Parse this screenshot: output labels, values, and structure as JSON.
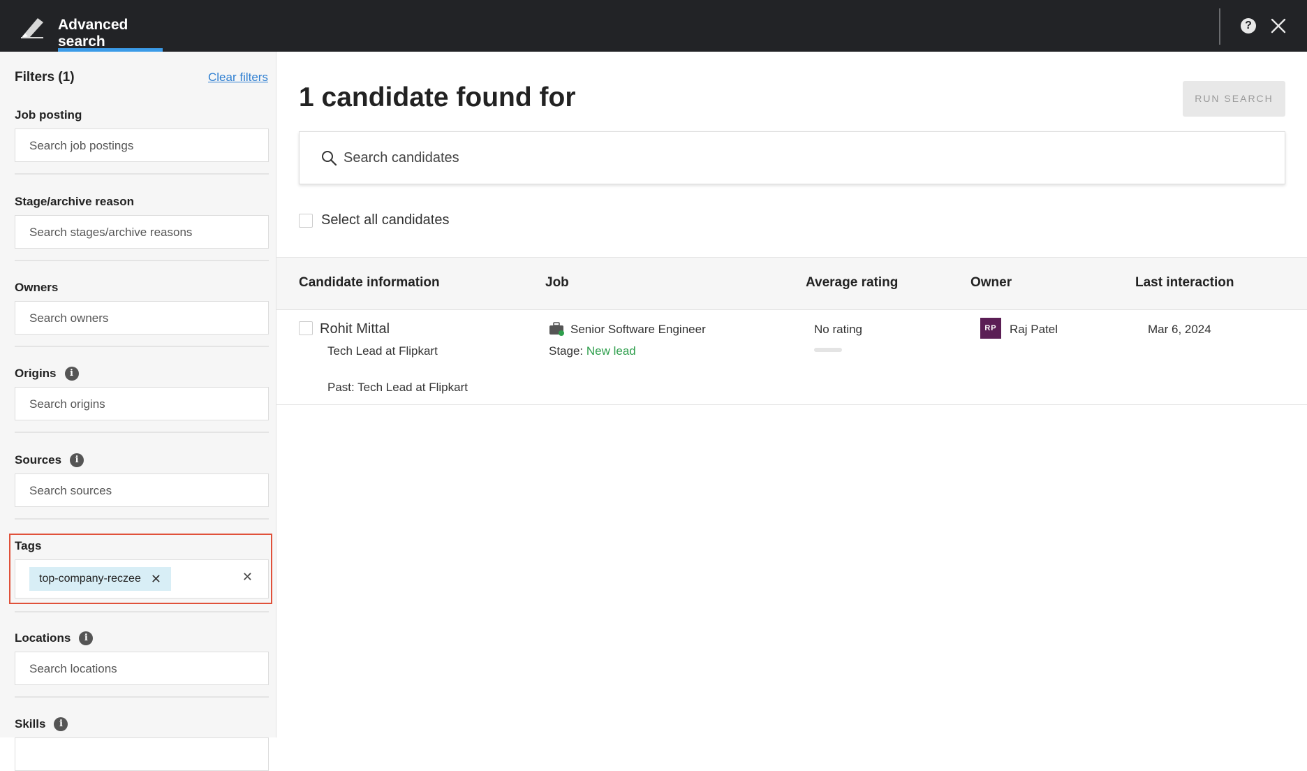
{
  "header": {
    "title": "Advanced search",
    "help_icon": "question-circle-icon",
    "close_icon": "close-icon"
  },
  "sidebar": {
    "filters_title": "Filters (1)",
    "clear_filters": "Clear filters",
    "job_posting": {
      "label": "Job posting",
      "placeholder": "Search job postings"
    },
    "stage": {
      "label": "Stage/archive reason",
      "placeholder": "Search stages/archive reasons"
    },
    "owners": {
      "label": "Owners",
      "placeholder": "Search owners"
    },
    "origins": {
      "label": "Origins",
      "placeholder": "Search origins"
    },
    "sources": {
      "label": "Sources",
      "placeholder": "Search sources"
    },
    "tags": {
      "label": "Tags",
      "chip": "top-company-reczee",
      "chip_remove": "✕",
      "clear": "✕"
    },
    "locations": {
      "label": "Locations",
      "placeholder": "Search locations"
    },
    "skills": {
      "label": "Skills"
    },
    "info_glyph": "i"
  },
  "main": {
    "title": "1 candidate found for",
    "run_search": "RUN SEARCH",
    "search_placeholder": "Search candidates",
    "select_all": "Select all candidates"
  },
  "table": {
    "columns": [
      "Candidate information",
      "Job",
      "Average rating",
      "Owner",
      "Last interaction"
    ],
    "rows": [
      {
        "name": "Rohit Mittal",
        "headline": "Tech Lead at Flipkart",
        "past": "Past: Tech Lead at Flipkart",
        "job": "Senior Software Engineer",
        "stage_label": "Stage:",
        "stage_value": "New lead",
        "rating": "No rating",
        "owner_initials": "RP",
        "owner_name": "Raj Patel",
        "last_interaction": "Mar 6, 2024"
      }
    ]
  },
  "colors": {
    "accent": "#3b9be8",
    "link": "#2f7fd1",
    "stage_green": "#2e9e4c",
    "highlight": "#e0513a",
    "avatar": "#5b1e55",
    "chip": "#d8eef6"
  }
}
